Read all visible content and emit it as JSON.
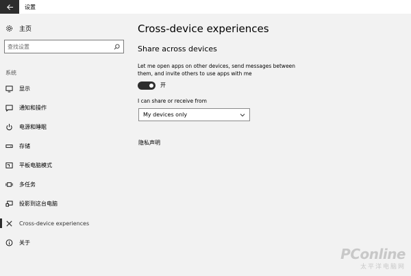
{
  "titlebar": {
    "title": "设置"
  },
  "sidebar": {
    "home_label": "主页",
    "search_placeholder": "查找设置",
    "section_label": "系统",
    "items": [
      {
        "label": "显示",
        "icon": "display-icon"
      },
      {
        "label": "通知和操作",
        "icon": "notification-icon"
      },
      {
        "label": "电源和睡眠",
        "icon": "power-icon"
      },
      {
        "label": "存储",
        "icon": "storage-icon"
      },
      {
        "label": "平板电脑模式",
        "icon": "tablet-icon"
      },
      {
        "label": "多任务",
        "icon": "multitask-icon"
      },
      {
        "label": "投影到这台电脑",
        "icon": "project-icon"
      },
      {
        "label": "Cross-device experiences",
        "icon": "cross-device-icon",
        "active": true
      },
      {
        "label": "关于",
        "icon": "info-icon"
      }
    ]
  },
  "main": {
    "title": "Cross-device experiences",
    "subtitle": "Share across devices",
    "description": "Let me open apps on other devices, send messages between them, and invite others to use apps with me",
    "toggle": {
      "state_label": "开",
      "on": true
    },
    "share_label": "I can share or receive from",
    "dropdown_value": "My devices only",
    "privacy_link": "隐私声明"
  },
  "watermark": {
    "brand": "PConline",
    "sub": "太平洋电脑网"
  },
  "colors": {
    "accent": "#2d2d2d",
    "background": "#f2f2f2"
  }
}
